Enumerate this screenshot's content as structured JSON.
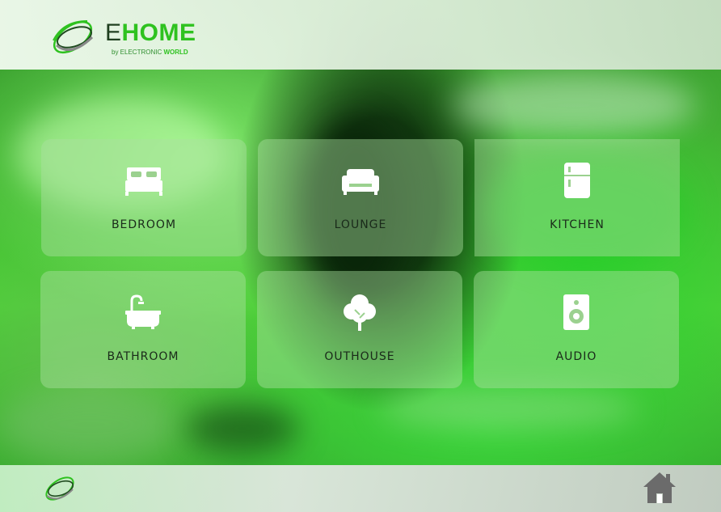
{
  "brand": {
    "name_e": "E",
    "name_rest": "HOME",
    "tagline_prefix": "by ELECTRONIC ",
    "tagline_bold": "WORLD",
    "accent": "#2ec21f"
  },
  "rooms": [
    {
      "label": "BEDROOM",
      "icon": "bed-icon"
    },
    {
      "label": "LOUNGE",
      "icon": "sofa-icon"
    },
    {
      "label": "KITCHEN",
      "icon": "fridge-icon"
    },
    {
      "label": "BATHROOM",
      "icon": "bathtub-icon"
    },
    {
      "label": "OUTHOUSE",
      "icon": "tree-icon"
    },
    {
      "label": "AUDIO",
      "icon": "speaker-icon"
    }
  ],
  "footer": {
    "home_icon": "home-icon"
  }
}
